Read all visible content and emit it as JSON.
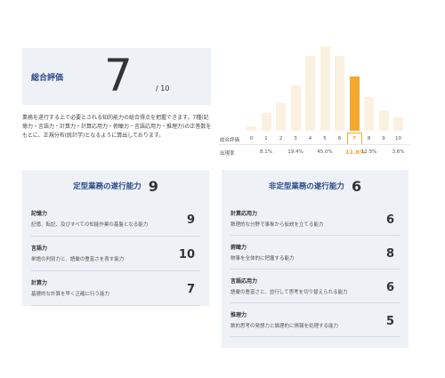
{
  "overall": {
    "label": "総合評価",
    "score": "7",
    "max": "/ 10"
  },
  "description": "業務を遂行する上で必要とされる知的能力の総合得点を把握できます。7種(記憶力・言語力・計算力・計算応用力・俯瞰力・言語応用力・推理力)の正答数をもとに、正規分布(統計学)となるように算出しております。",
  "chart_data": {
    "type": "bar",
    "categories": [
      "0",
      "1",
      "2",
      "3",
      "4",
      "5",
      "6",
      "7",
      "8",
      "9",
      "10"
    ],
    "values": [
      0.5,
      2.1,
      3.3,
      5.5,
      9.0,
      10.2,
      9.0,
      6.6,
      4.1,
      2.5,
      1.6
    ],
    "highlight_index": 7,
    "highlight_color": "#f5a82e",
    "bar_color": "#fbf1e0",
    "row_labels": {
      "score": "総合評価",
      "rate": "出現率"
    },
    "rates": [
      {
        "x": "1",
        "label": "8.1%"
      },
      {
        "x": "3",
        "label": "19.4%"
      },
      {
        "x": "5",
        "label": "45.0%"
      },
      {
        "x": "7",
        "label": "11.6%"
      },
      {
        "x": "8",
        "label": "12.3%"
      },
      {
        "x": "10",
        "label": "3.6%"
      }
    ]
  },
  "routine": {
    "title": "定型業務の遂行能力",
    "score": "9",
    "items": [
      {
        "name": "記憶力",
        "desc": "記憶、転記、及びすべての知能作業の基盤となる能力",
        "score": "9"
      },
      {
        "name": "言語力",
        "desc": "単語の判別力と、語彙の豊富さを表す能力",
        "score": "10"
      },
      {
        "name": "計算力",
        "desc": "基礎的な計算を早く正確に行う能力",
        "score": "7"
      }
    ]
  },
  "nonroutine": {
    "title": "非定型業務の遂行能力",
    "score": "6",
    "items": [
      {
        "name": "計算応用力",
        "desc": "数理的な分野で事象から仮説を立てる能力",
        "score": "6"
      },
      {
        "name": "俯瞰力",
        "desc": "物事を全体的に把握する能力",
        "score": "8"
      },
      {
        "name": "言語応用力",
        "desc": "語彙の豊富さと、並行して思考を切り替えられる能力",
        "score": "6"
      },
      {
        "name": "推理力",
        "desc": "数的思考の発想力と論理的に情報を処理する能力",
        "score": "5"
      }
    ]
  },
  "colors": {
    "accent": "#2b4a8a",
    "panel_bg": "#eef1f6",
    "highlight": "#f5a82e"
  }
}
